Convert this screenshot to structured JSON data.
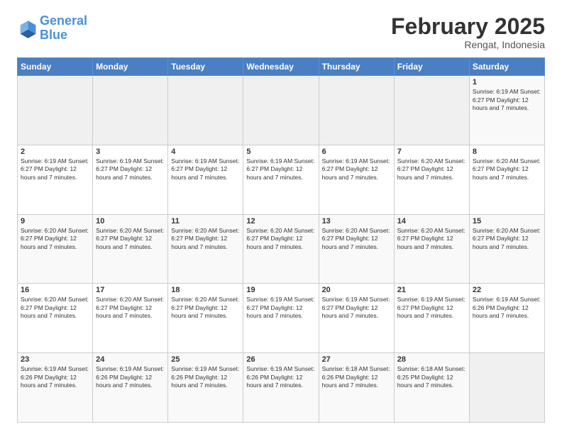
{
  "logo": {
    "line1": "General",
    "line2": "Blue"
  },
  "header": {
    "month": "February 2025",
    "location": "Rengat, Indonesia"
  },
  "weekdays": [
    "Sunday",
    "Monday",
    "Tuesday",
    "Wednesday",
    "Thursday",
    "Friday",
    "Saturday"
  ],
  "weeks": [
    [
      {
        "day": "",
        "info": ""
      },
      {
        "day": "",
        "info": ""
      },
      {
        "day": "",
        "info": ""
      },
      {
        "day": "",
        "info": ""
      },
      {
        "day": "",
        "info": ""
      },
      {
        "day": "",
        "info": ""
      },
      {
        "day": "1",
        "info": "Sunrise: 6:19 AM\nSunset: 6:27 PM\nDaylight: 12 hours and 7 minutes."
      }
    ],
    [
      {
        "day": "2",
        "info": "Sunrise: 6:19 AM\nSunset: 6:27 PM\nDaylight: 12 hours and 7 minutes."
      },
      {
        "day": "3",
        "info": "Sunrise: 6:19 AM\nSunset: 6:27 PM\nDaylight: 12 hours and 7 minutes."
      },
      {
        "day": "4",
        "info": "Sunrise: 6:19 AM\nSunset: 6:27 PM\nDaylight: 12 hours and 7 minutes."
      },
      {
        "day": "5",
        "info": "Sunrise: 6:19 AM\nSunset: 6:27 PM\nDaylight: 12 hours and 7 minutes."
      },
      {
        "day": "6",
        "info": "Sunrise: 6:19 AM\nSunset: 6:27 PM\nDaylight: 12 hours and 7 minutes."
      },
      {
        "day": "7",
        "info": "Sunrise: 6:20 AM\nSunset: 6:27 PM\nDaylight: 12 hours and 7 minutes."
      },
      {
        "day": "8",
        "info": "Sunrise: 6:20 AM\nSunset: 6:27 PM\nDaylight: 12 hours and 7 minutes."
      }
    ],
    [
      {
        "day": "9",
        "info": "Sunrise: 6:20 AM\nSunset: 6:27 PM\nDaylight: 12 hours and 7 minutes."
      },
      {
        "day": "10",
        "info": "Sunrise: 6:20 AM\nSunset: 6:27 PM\nDaylight: 12 hours and 7 minutes."
      },
      {
        "day": "11",
        "info": "Sunrise: 6:20 AM\nSunset: 6:27 PM\nDaylight: 12 hours and 7 minutes."
      },
      {
        "day": "12",
        "info": "Sunrise: 6:20 AM\nSunset: 6:27 PM\nDaylight: 12 hours and 7 minutes."
      },
      {
        "day": "13",
        "info": "Sunrise: 6:20 AM\nSunset: 6:27 PM\nDaylight: 12 hours and 7 minutes."
      },
      {
        "day": "14",
        "info": "Sunrise: 6:20 AM\nSunset: 6:27 PM\nDaylight: 12 hours and 7 minutes."
      },
      {
        "day": "15",
        "info": "Sunrise: 6:20 AM\nSunset: 6:27 PM\nDaylight: 12 hours and 7 minutes."
      }
    ],
    [
      {
        "day": "16",
        "info": "Sunrise: 6:20 AM\nSunset: 6:27 PM\nDaylight: 12 hours and 7 minutes."
      },
      {
        "day": "17",
        "info": "Sunrise: 6:20 AM\nSunset: 6:27 PM\nDaylight: 12 hours and 7 minutes."
      },
      {
        "day": "18",
        "info": "Sunrise: 6:20 AM\nSunset: 6:27 PM\nDaylight: 12 hours and 7 minutes."
      },
      {
        "day": "19",
        "info": "Sunrise: 6:19 AM\nSunset: 6:27 PM\nDaylight: 12 hours and 7 minutes."
      },
      {
        "day": "20",
        "info": "Sunrise: 6:19 AM\nSunset: 6:27 PM\nDaylight: 12 hours and 7 minutes."
      },
      {
        "day": "21",
        "info": "Sunrise: 6:19 AM\nSunset: 6:27 PM\nDaylight: 12 hours and 7 minutes."
      },
      {
        "day": "22",
        "info": "Sunrise: 6:19 AM\nSunset: 6:26 PM\nDaylight: 12 hours and 7 minutes."
      }
    ],
    [
      {
        "day": "23",
        "info": "Sunrise: 6:19 AM\nSunset: 6:26 PM\nDaylight: 12 hours and 7 minutes."
      },
      {
        "day": "24",
        "info": "Sunrise: 6:19 AM\nSunset: 6:26 PM\nDaylight: 12 hours and 7 minutes."
      },
      {
        "day": "25",
        "info": "Sunrise: 6:19 AM\nSunset: 6:26 PM\nDaylight: 12 hours and 7 minutes."
      },
      {
        "day": "26",
        "info": "Sunrise: 6:19 AM\nSunset: 6:26 PM\nDaylight: 12 hours and 7 minutes."
      },
      {
        "day": "27",
        "info": "Sunrise: 6:18 AM\nSunset: 6:26 PM\nDaylight: 12 hours and 7 minutes."
      },
      {
        "day": "28",
        "info": "Sunrise: 6:18 AM\nSunset: 6:25 PM\nDaylight: 12 hours and 7 minutes."
      },
      {
        "day": "",
        "info": ""
      }
    ]
  ]
}
